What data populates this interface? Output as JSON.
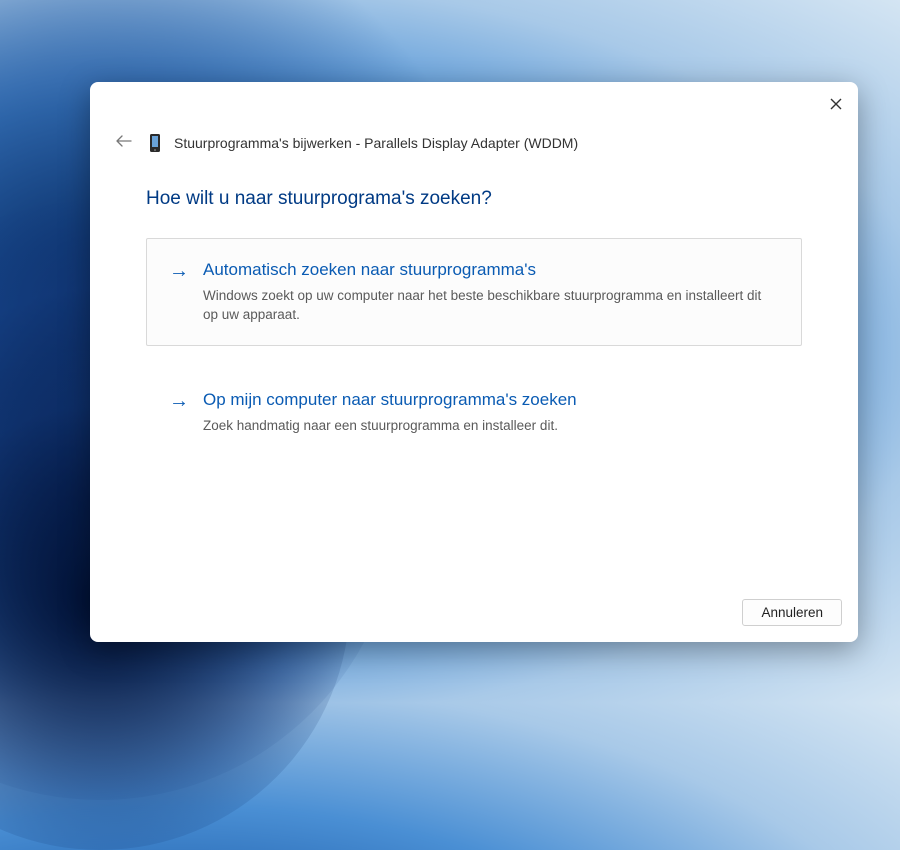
{
  "header": {
    "title": "Stuurprogramma's bijwerken - Parallels Display Adapter (WDDM)"
  },
  "question": "Hoe wilt u naar stuurprograma's zoeken?",
  "options": [
    {
      "title": "Automatisch zoeken naar stuurprogramma's",
      "description": "Windows zoekt op uw computer naar het beste beschikbare stuurprogramma en installeert dit op uw apparaat."
    },
    {
      "title": "Op mijn computer naar stuurprogramma's zoeken",
      "description": "Zoek handmatig naar een stuurprogramma en installeer dit."
    }
  ],
  "buttons": {
    "cancel": "Annuleren"
  }
}
